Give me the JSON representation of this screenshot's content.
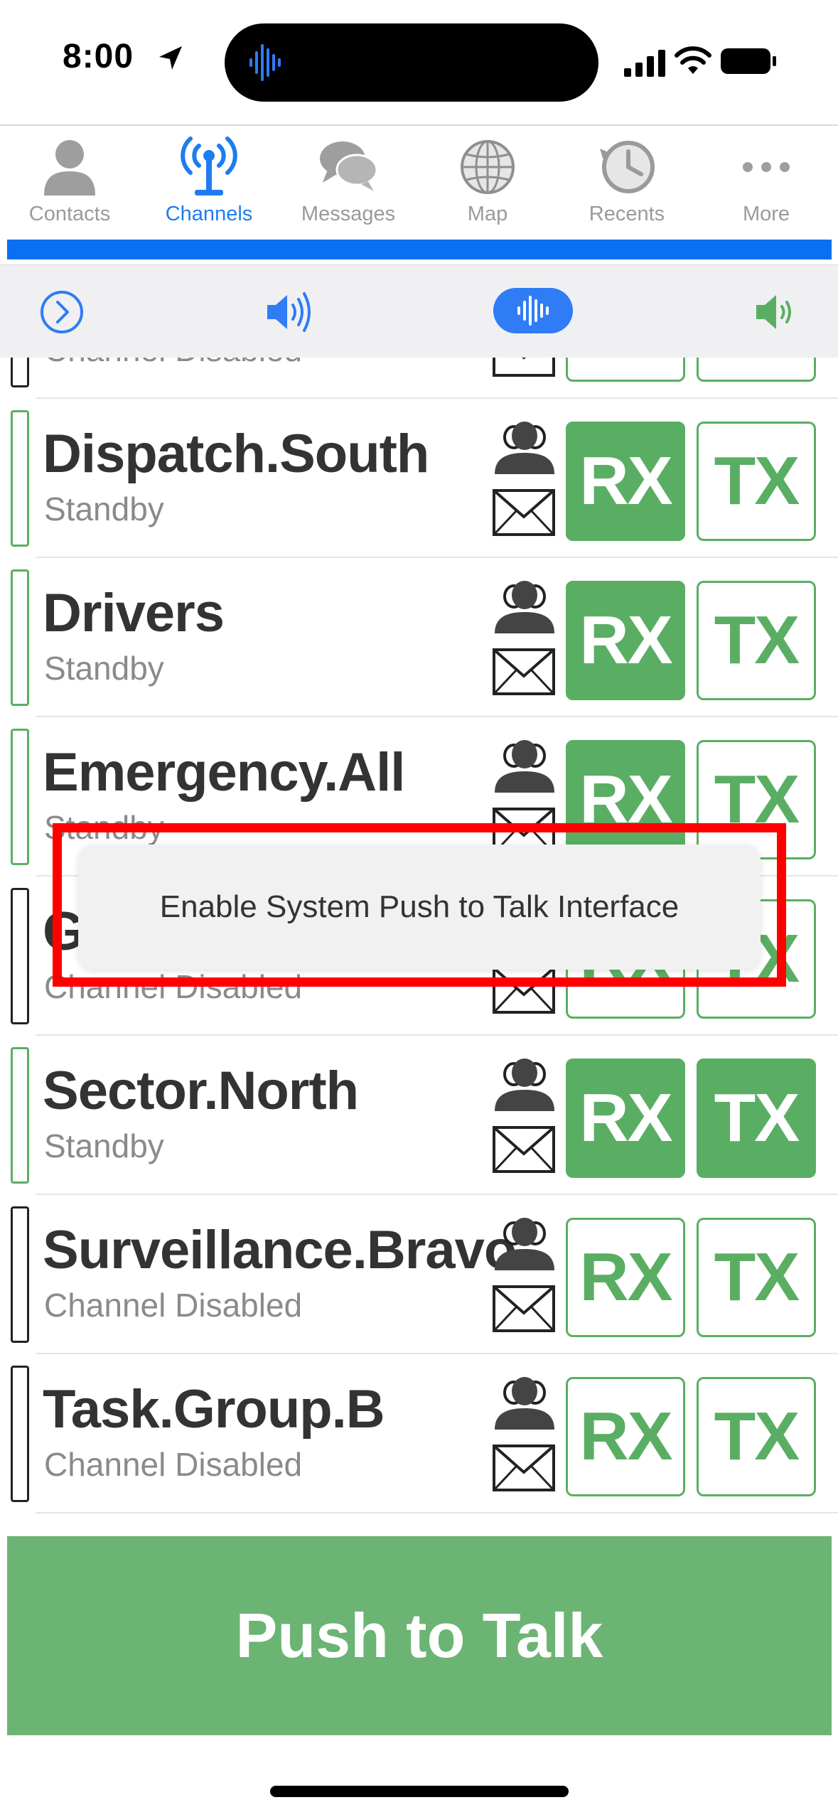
{
  "status_bar": {
    "time": "8:00"
  },
  "tabs": [
    {
      "label": "Contacts",
      "icon": "person-icon",
      "active": false
    },
    {
      "label": "Channels",
      "icon": "antenna-icon",
      "active": true
    },
    {
      "label": "Messages",
      "icon": "chat-bubbles-icon",
      "active": false
    },
    {
      "label": "Map",
      "icon": "globe-icon",
      "active": false
    },
    {
      "label": "Recents",
      "icon": "history-clock-icon",
      "active": false
    },
    {
      "label": "More",
      "icon": "ellipsis-icon",
      "active": false
    }
  ],
  "channels": [
    {
      "name": "",
      "status": "Channel Disabled",
      "enabled": false,
      "rx": "",
      "tx": ""
    },
    {
      "name": "Dispatch.South",
      "status": "Standby",
      "enabled": true,
      "rx": "RX",
      "tx": "TX",
      "rx_filled": true,
      "tx_filled": false
    },
    {
      "name": "Drivers",
      "status": "Standby",
      "enabled": true,
      "rx": "RX",
      "tx": "TX",
      "rx_filled": true,
      "tx_filled": false
    },
    {
      "name": "Emergency.All",
      "status": "Standby",
      "enabled": true,
      "rx": "RX",
      "tx": "TX",
      "rx_filled": true,
      "tx_filled": false
    },
    {
      "name": "G",
      "status": "Channel Disabled",
      "enabled": false,
      "rx": "RX",
      "tx": "TX",
      "rx_filled": false,
      "tx_filled": false
    },
    {
      "name": "Sector.North",
      "status": "Standby",
      "enabled": true,
      "rx": "RX",
      "tx": "TX",
      "rx_filled": true,
      "tx_filled": true
    },
    {
      "name": "Surveillance.Bravo",
      "status": "Channel Disabled",
      "enabled": false,
      "rx": "RX",
      "tx": "TX",
      "rx_filled": false,
      "tx_filled": false
    },
    {
      "name": "Task.Group.B",
      "status": "Channel Disabled",
      "enabled": false,
      "rx": "RX",
      "tx": "TX",
      "rx_filled": false,
      "tx_filled": false
    }
  ],
  "toast": {
    "text": "Enable System Push to Talk Interface"
  },
  "push_to_talk": {
    "label": "Push to Talk"
  },
  "colors": {
    "accent_blue": "#1e7cf2",
    "green": "#5aae63",
    "highlight": "#ff0000"
  }
}
